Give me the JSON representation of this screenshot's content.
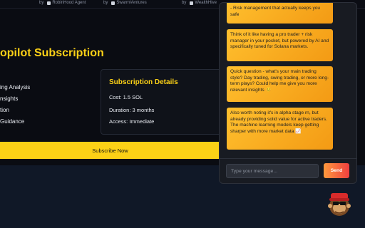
{
  "topbar": {
    "credits": [
      {
        "by": "by",
        "name": "RobinHood Agent",
        "icon": "robinhood-icon"
      },
      {
        "by": "by",
        "name": "SwarmVentures",
        "icon": "swarm-icon"
      },
      {
        "by": "by",
        "name": "WealthHive",
        "icon": "wealthhive-icon"
      }
    ]
  },
  "main": {
    "title": "opilot Subscription",
    "features": [
      "ing Analysis",
      "nsights",
      "tion",
      "Guidance"
    ],
    "details": {
      "heading": "Subscription Details",
      "cost": "Cost: 1.5 SOL",
      "duration": "Duration: 3 months",
      "access": "Access: Immediate"
    },
    "subscribe_label": "Subscribe Now"
  },
  "chat": {
    "messages": [
      "- Risk management that actually keeps you safe",
      "Think of it like having a pro trader + risk manager in your pocket, but powered by AI and specifically tuned for Solana markets.",
      "Quick question - what's your main trading style? Day trading, swing trading, or more long-term plays? Could help me give you more relevant insights 😊",
      "Also worth noting it's in alpha stage rn, but already providing solid value for active traders. The machine learning models keep getting sharper with more market data 📈"
    ],
    "input_placeholder": "Type your message...",
    "send_label": "Send"
  },
  "colors": {
    "accent": "#fcd116",
    "bubble": "#ffb51f",
    "send": "#f0573b"
  }
}
